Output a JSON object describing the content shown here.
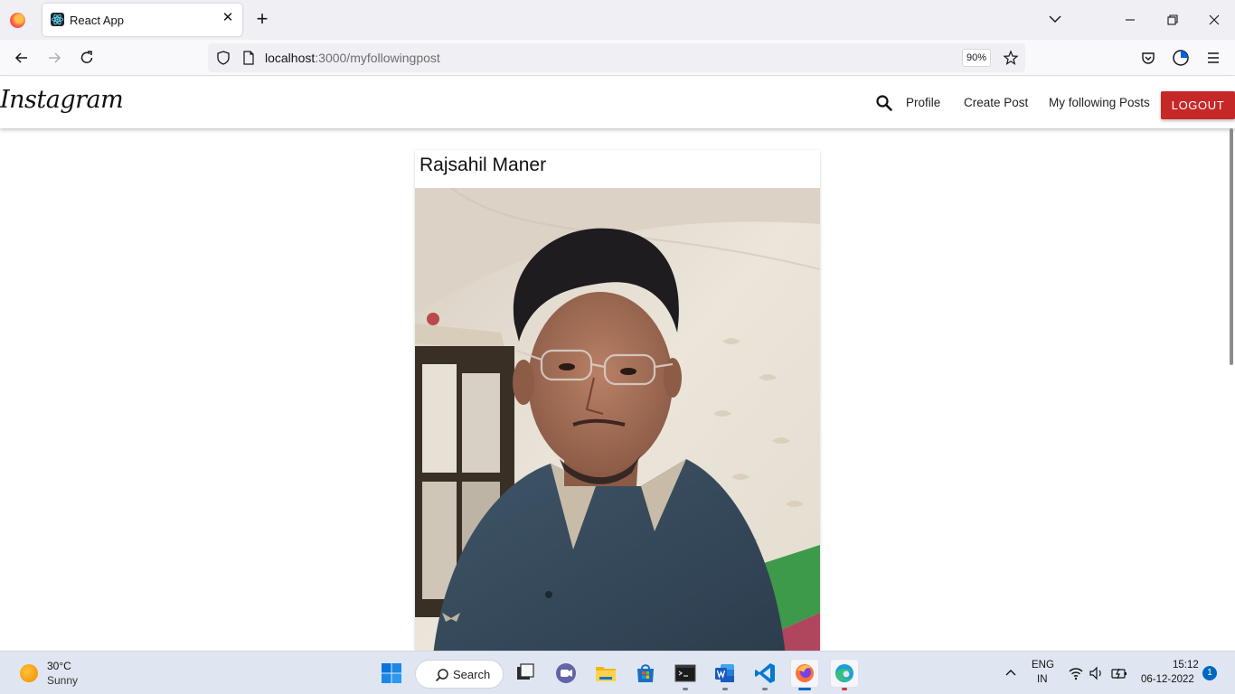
{
  "browser": {
    "tab_title": "React App",
    "url_host": "localhost",
    "url_path": ":3000/myfollowingpost",
    "zoom": "90%"
  },
  "header": {
    "brand": "Instagram",
    "nav": {
      "profile": "Profile",
      "create_post": "Create Post",
      "following_posts": "My following Posts",
      "logout": "LOGOUT"
    },
    "accent_color": "#c62828"
  },
  "post": {
    "user_name": "Rajsahil Maner",
    "photo_icon": "selfie-photo"
  },
  "taskbar": {
    "weather_temp": "30°C",
    "weather_condition": "Sunny",
    "search_label": "Search",
    "lang_line1": "ENG",
    "lang_line2": "IN",
    "time": "15:12",
    "date": "06-12-2022",
    "notification_count": "1"
  }
}
